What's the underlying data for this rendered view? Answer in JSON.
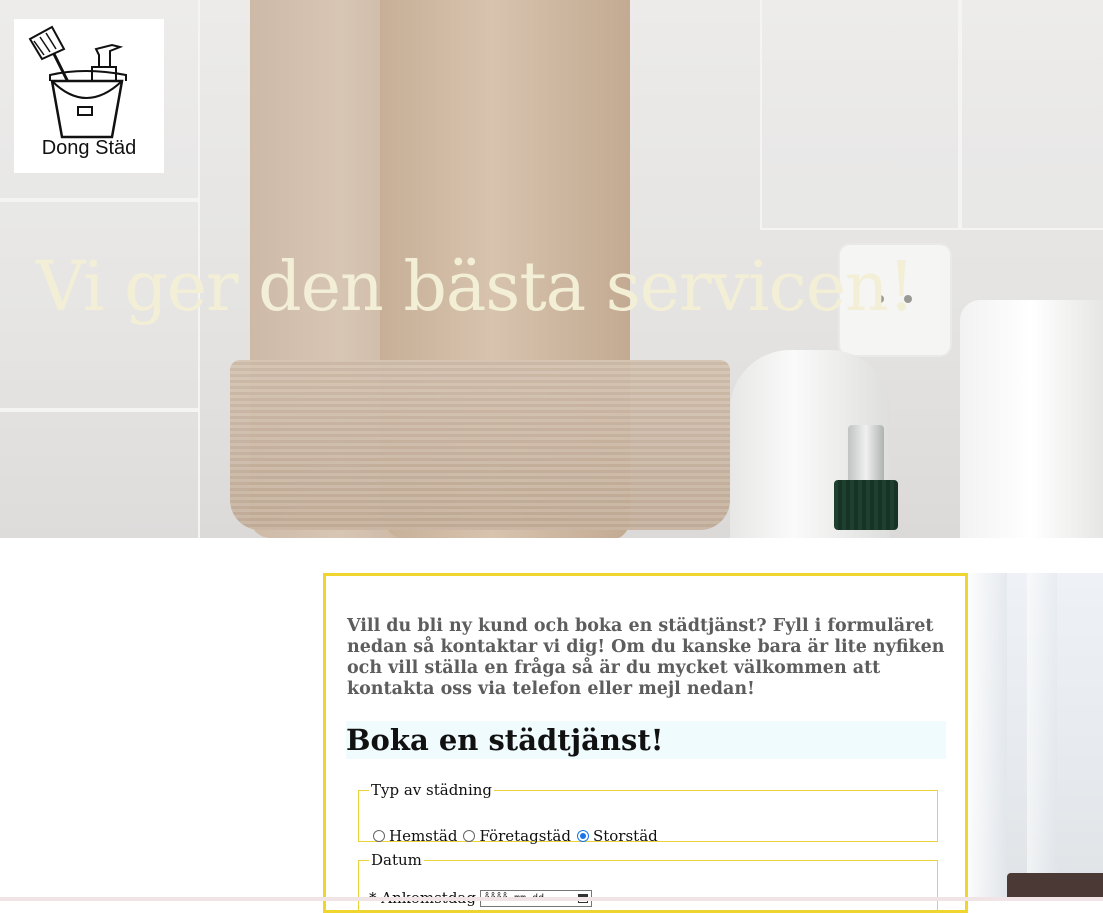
{
  "brand": {
    "logo_text": "Dong Städ"
  },
  "hero": {
    "title": "Vi ger den bästa servicen!"
  },
  "intro": {
    "text": "Vill du bli ny kund och boka en städtjänst? Fyll i formuläret nedan så kontaktar vi dig! Om du kanske bara är lite nyfiken och vill ställa en fråga så är du mycket välkommen att kontakta oss via telefon eller mejl nedan!"
  },
  "booking": {
    "heading": "Boka en städtjänst!",
    "type_legend": "Typ av städning",
    "options": [
      {
        "label": "Hemstäd",
        "checked": false
      },
      {
        "label": "Företagstäd",
        "checked": false
      },
      {
        "label": "Storstäd",
        "checked": true
      }
    ],
    "date_legend": "Datum",
    "arrival_label": "* Ankomstdag",
    "arrival_value": "åååå-mm-dd"
  },
  "colors": {
    "card_border": "#f0d52e",
    "heading_bg": "#effbfd",
    "hero_title": "#f3efd6",
    "radio_selected": "#1a73e8"
  }
}
